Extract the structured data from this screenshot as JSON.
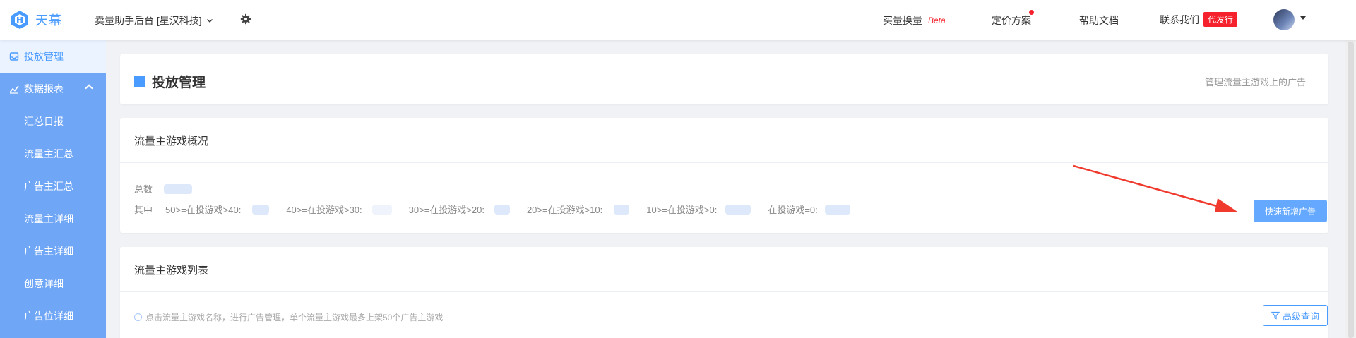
{
  "app": {
    "logo_text": "天幕",
    "workspace": "卖量助手后台 [星汉科技]"
  },
  "topnav": {
    "buy_swap": "买量换量",
    "beta": "Beta",
    "pricing": "定价方案",
    "help_docs": "帮助文档",
    "contact": "联系我们",
    "contact_badge": "代发行"
  },
  "sidebar": {
    "items": [
      {
        "label": "投放管理",
        "icon": "inbox-icon",
        "active": true
      },
      {
        "label": "数据报表",
        "icon": "trend-chart-icon",
        "expanded": true
      },
      {
        "label": "汇总日报"
      },
      {
        "label": "流量主汇总"
      },
      {
        "label": "广告主汇总"
      },
      {
        "label": "流量主详细"
      },
      {
        "label": "广告主详细"
      },
      {
        "label": "创意详细"
      },
      {
        "label": "广告位详细"
      }
    ]
  },
  "page": {
    "title": "投放管理",
    "subtitle": "- 管理流量主游戏上的广告"
  },
  "overview": {
    "title": "流量主游戏概况",
    "total_label": "总数",
    "breakdown_label": "其中",
    "buckets": [
      "50>=在投游戏>40:",
      "40>=在投游戏>30:",
      "30>=在投游戏>20:",
      "20>=在投游戏>10:",
      "10>=在投游戏>0:",
      "在投游戏=0:"
    ],
    "quick_add_button": "快速新增广告"
  },
  "list": {
    "title": "流量主游戏列表",
    "hint": "点击流量主游戏名称，进行广告管理，单个流量主游戏最多上架50个广告主游戏",
    "advanced_search_button": "高级查询"
  },
  "colors": {
    "accent": "#4a9bff",
    "sidebar_bg": "#6fa6f5",
    "danger": "#f5222d",
    "annotation_arrow": "#f03a2e"
  }
}
